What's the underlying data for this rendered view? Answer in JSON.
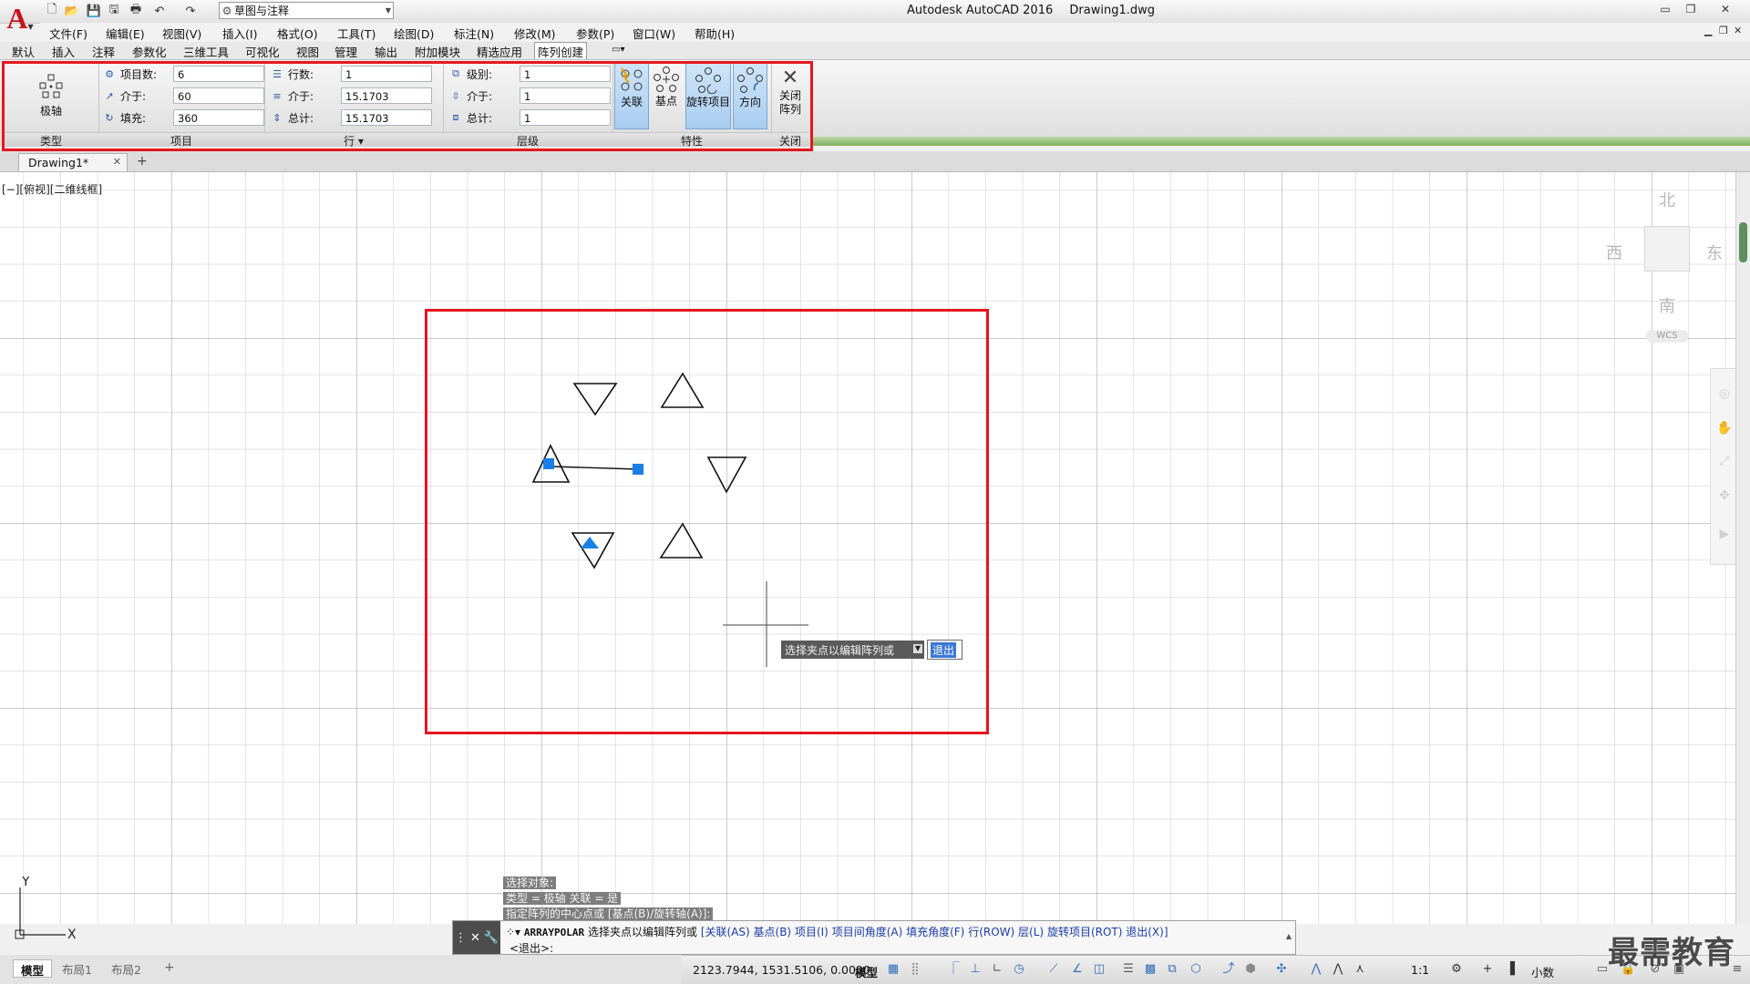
{
  "titlebar": {
    "app_name": "Autodesk AutoCAD 2016",
    "file_name": "Drawing1.dwg",
    "workspace": "草图与注释"
  },
  "menu": [
    "文件(F)",
    "编辑(E)",
    "视图(V)",
    "插入(I)",
    "格式(O)",
    "工具(T)",
    "绘图(D)",
    "标注(N)",
    "修改(M)",
    "参数(P)",
    "窗口(W)",
    "帮助(H)"
  ],
  "ribbon_tabs": [
    "默认",
    "插入",
    "注释",
    "参数化",
    "三维工具",
    "可视化",
    "视图",
    "管理",
    "输出",
    "附加模块",
    "精选应用",
    "阵列创建"
  ],
  "ribbon": {
    "type_panel": {
      "button_label": "极轴",
      "title": "类型"
    },
    "items_panel": {
      "title": "项目",
      "rows": [
        {
          "label": "项目数:",
          "value": "6"
        },
        {
          "label": "介于:",
          "value": "60"
        },
        {
          "label": "填充:",
          "value": "360"
        }
      ]
    },
    "rows_panel": {
      "title": "行 ▾",
      "rows": [
        {
          "label": "行数:",
          "value": "1"
        },
        {
          "label": "介于:",
          "value": "15.1703"
        },
        {
          "label": "总计:",
          "value": "15.1703"
        }
      ]
    },
    "levels_panel": {
      "title": "层级",
      "rows": [
        {
          "label": "级别:",
          "value": "1"
        },
        {
          "label": "介于:",
          "value": "1"
        },
        {
          "label": "总计:",
          "value": "1"
        }
      ]
    },
    "properties_panel": {
      "title": "特性",
      "buttons": [
        "关联",
        "基点",
        "旋转项目",
        "方向"
      ]
    },
    "close_panel": {
      "title": "关闭",
      "button_label": "关闭\n阵列"
    }
  },
  "doc_tab": {
    "name": "Drawing1*"
  },
  "viewport_label": "[−][俯视][二维线框]",
  "viewcube": {
    "north": "北",
    "south": "南",
    "east": "东",
    "west": "西",
    "wcs": "WCS"
  },
  "grip_prompt": {
    "text": "选择夹点以编辑阵列或",
    "option": "退出"
  },
  "ucs": {
    "x": "X",
    "y": "Y"
  },
  "command_history": [
    "选择对象:",
    "类型 = 极轴  关联 = 是",
    "指定阵列的中心点或 [基点(B)/旋转轴(A)]:"
  ],
  "command_line": {
    "command": "ARRAYPOLAR",
    "prompt": "选择夹点以编辑阵列或",
    "options": [
      "[关联(AS)",
      "基点(B)",
      "项目(I)",
      "项目间角度(A)",
      "填充角度(F)",
      "行(ROW)",
      "层(L)",
      "旋转项目(ROT)",
      "退出(X)]"
    ],
    "current": "<退出>:"
  },
  "layout_tabs": [
    "模型",
    "布局1",
    "布局2"
  ],
  "status": {
    "coords": "2123.7944, 1531.5106, 0.0000",
    "model": "模型",
    "scale": "1:1",
    "units": "小数"
  },
  "watermark": "最需教育",
  "colors": {
    "highlight_red": "#e5161f",
    "grip_blue": "#1a7fe8",
    "accent_green": "#7fae5c"
  }
}
